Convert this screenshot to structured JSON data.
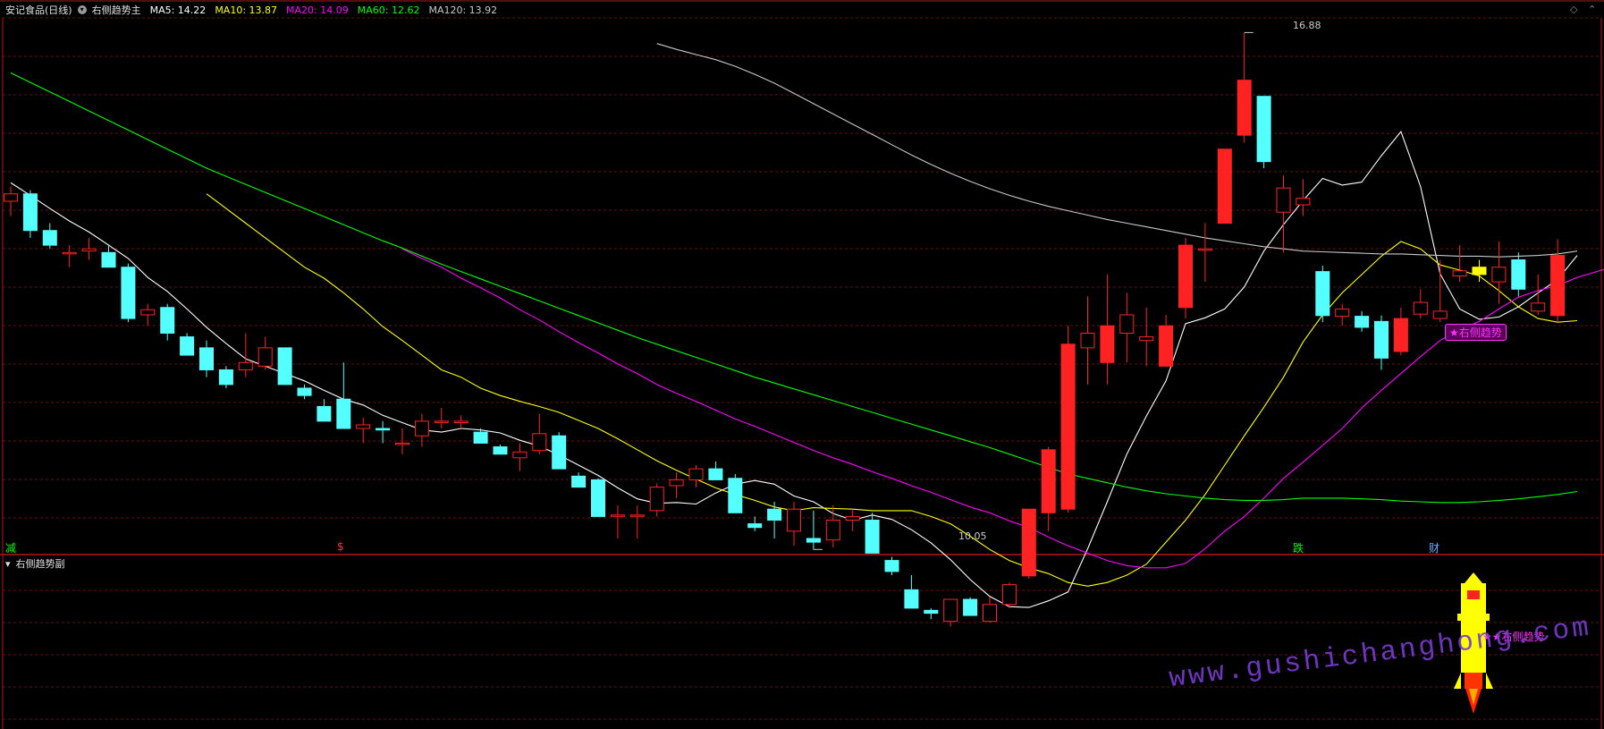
{
  "header": {
    "stock_name": "安记食品(日线)",
    "indicator": "右侧趋势主",
    "ma_labels": [
      {
        "text": "MA5: 14.22",
        "color": "#ffffff"
      },
      {
        "text": "MA10: 13.87",
        "color": "#ffff00"
      },
      {
        "text": "MA20: 14.09",
        "color": "#ff00ff"
      },
      {
        "text": "MA60: 12.62",
        "color": "#00ff00"
      },
      {
        "text": "MA120: 13.92",
        "color": "#c8c8c8"
      }
    ]
  },
  "sub_panel": {
    "title": "右侧趋势副"
  },
  "markers": {
    "m1": {
      "text": "减",
      "color": "#00ff00"
    },
    "m2": {
      "text": "$",
      "color": "#ff3333"
    },
    "m3": {
      "text": "跌",
      "color": "#00ff00"
    },
    "m4": {
      "text": "财",
      "color": "#66aaff"
    }
  },
  "annotations": {
    "high_label": "16.88",
    "low_label": "10.05",
    "signal_label": "★右侧趋势",
    "rocket_label": "★★右侧趋势"
  },
  "watermark": "www.gushichanghong.com",
  "colors": {
    "up": "#ff2222",
    "down": "#54ffff",
    "grid": "#8a1515",
    "border": "#b01818",
    "ma5": "#ffffff",
    "ma10": "#ffff00",
    "ma20": "#ff00ff",
    "ma60": "#00ff00",
    "ma120": "#c8c8c8",
    "highlight": "#ffff00"
  },
  "chart_data": {
    "type": "candlestick",
    "ylim": [
      10.0,
      17.1
    ],
    "series_ohlc": [
      [
        14.6,
        14.8,
        14.4,
        14.7
      ],
      [
        14.7,
        14.75,
        14.1,
        14.2
      ],
      [
        14.2,
        14.3,
        13.95,
        14.0
      ],
      [
        13.9,
        14.0,
        13.7,
        13.9
      ],
      [
        13.92,
        14.1,
        13.8,
        13.95
      ],
      [
        13.9,
        14.0,
        13.7,
        13.7
      ],
      [
        13.7,
        13.75,
        12.95,
        13.0
      ],
      [
        13.05,
        13.2,
        12.9,
        13.12
      ],
      [
        13.15,
        13.2,
        12.7,
        12.8
      ],
      [
        12.75,
        12.8,
        12.5,
        12.5
      ],
      [
        12.6,
        12.7,
        12.2,
        12.3
      ],
      [
        12.3,
        12.35,
        12.05,
        12.1
      ],
      [
        12.3,
        12.8,
        12.2,
        12.4
      ],
      [
        12.35,
        12.75,
        12.3,
        12.6
      ],
      [
        12.6,
        12.6,
        12.1,
        12.1
      ],
      [
        12.05,
        12.1,
        11.9,
        11.95
      ],
      [
        11.8,
        11.9,
        11.6,
        11.6
      ],
      [
        11.9,
        12.4,
        11.5,
        11.5
      ],
      [
        11.5,
        11.65,
        11.3,
        11.55
      ],
      [
        11.5,
        11.6,
        11.3,
        11.48
      ],
      [
        11.3,
        11.5,
        11.15,
        11.3
      ],
      [
        11.4,
        11.7,
        11.25,
        11.6
      ],
      [
        11.6,
        11.78,
        11.5,
        11.6
      ],
      [
        11.58,
        11.68,
        11.5,
        11.6
      ],
      [
        11.45,
        11.5,
        11.3,
        11.3
      ],
      [
        11.25,
        11.28,
        11.15,
        11.15
      ],
      [
        11.1,
        11.3,
        10.92,
        11.18
      ],
      [
        11.2,
        11.7,
        11.15,
        11.43
      ],
      [
        11.4,
        11.45,
        10.95,
        10.95
      ],
      [
        10.85,
        10.9,
        10.7,
        10.7
      ],
      [
        10.8,
        10.82,
        10.3,
        10.3
      ],
      [
        10.32,
        10.45,
        10.0,
        10.32
      ],
      [
        10.32,
        10.45,
        10.0,
        10.32
      ],
      [
        10.38,
        10.75,
        10.3,
        10.7
      ],
      [
        10.72,
        10.9,
        10.55,
        10.8
      ],
      [
        10.8,
        11.0,
        10.7,
        10.95
      ],
      [
        10.95,
        11.05,
        10.82,
        10.8
      ],
      [
        10.82,
        10.88,
        10.35,
        10.35
      ],
      [
        10.2,
        10.3,
        10.1,
        10.15
      ],
      [
        10.4,
        10.5,
        10.0,
        10.25
      ],
      [
        10.1,
        10.5,
        9.9,
        10.4
      ],
      [
        10.0,
        10.38,
        9.85,
        9.95
      ],
      [
        9.98,
        10.45,
        9.88,
        10.25
      ],
      [
        10.25,
        10.4,
        10.1,
        10.3
      ],
      [
        10.25,
        10.35,
        9.8,
        9.8
      ],
      [
        9.7,
        9.75,
        9.5,
        9.55
      ],
      [
        9.3,
        9.5,
        9.05,
        9.05
      ],
      [
        9.02,
        9.05,
        8.9,
        8.98
      ],
      [
        8.87,
        9.17,
        8.8,
        9.17
      ],
      [
        9.17,
        9.2,
        8.95,
        8.95
      ],
      [
        8.87,
        9.2,
        8.85,
        9.1
      ],
      [
        9.1,
        9.4,
        9.05,
        9.37
      ],
      [
        9.49,
        10.4,
        9.45,
        10.4
      ],
      [
        10.35,
        11.25,
        10.1,
        11.21
      ],
      [
        10.4,
        12.9,
        10.35,
        12.65
      ],
      [
        12.6,
        13.3,
        12.1,
        12.8
      ],
      [
        12.4,
        13.6,
        12.1,
        12.9
      ],
      [
        12.8,
        13.35,
        12.4,
        13.05
      ],
      [
        12.7,
        13.15,
        12.35,
        12.75
      ],
      [
        12.35,
        13.05,
        12.35,
        12.9
      ],
      [
        13.15,
        14.1,
        13.0,
        14.0
      ],
      [
        13.95,
        14.3,
        13.5,
        13.95
      ],
      [
        14.3,
        15.3,
        14.3,
        15.31
      ],
      [
        15.5,
        16.9,
        15.4,
        16.25
      ],
      [
        16.03,
        15.94,
        15.05,
        15.14
      ],
      [
        14.45,
        14.95,
        13.9,
        14.78
      ],
      [
        14.55,
        14.9,
        14.4,
        14.64
      ],
      [
        13.64,
        13.72,
        12.95,
        13.04
      ],
      [
        13.03,
        13.2,
        12.9,
        13.13
      ],
      [
        13.03,
        13.1,
        12.82,
        12.88
      ],
      [
        12.96,
        13.04,
        12.3,
        12.46
      ],
      [
        12.55,
        13.15,
        12.5,
        13.0
      ],
      [
        13.06,
        13.4,
        13.0,
        13.22
      ],
      [
        13.0,
        13.8,
        12.95,
        13.1
      ],
      [
        13.58,
        14.0,
        13.5,
        13.65
      ],
      [
        13.7,
        13.8,
        13.5,
        13.6
      ],
      [
        13.5,
        14.05,
        13.2,
        13.7
      ],
      [
        13.8,
        13.9,
        13.3,
        13.4
      ],
      [
        13.1,
        13.6,
        13.05,
        13.21
      ],
      [
        13.04,
        14.08,
        12.95,
        13.86
      ]
    ],
    "ma_series": [
      {
        "name": "MA5",
        "color": "#ffffff",
        "values": [
          14.85,
          14.68,
          14.5,
          14.33,
          14.18,
          14.0,
          13.82,
          13.56,
          13.37,
          13.13,
          12.88,
          12.66,
          12.45,
          12.35,
          12.25,
          12.15,
          12.02,
          11.9,
          11.82,
          11.68,
          11.58,
          11.48,
          11.45,
          11.5,
          11.48,
          11.44,
          11.34,
          11.26,
          11.14,
          11.0,
          10.86,
          10.69,
          10.54,
          10.48,
          10.49,
          10.47,
          10.62,
          10.74,
          10.79,
          10.74,
          10.58,
          10.5,
          10.34,
          10.25,
          10.32,
          10.26,
          10.12,
          9.94,
          9.71,
          9.44,
          9.21,
          9.07,
          9.06,
          9.15,
          9.27,
          9.86,
          10.5,
          11.15,
          11.67,
          12.15,
          12.93,
          13.01,
          13.13,
          13.43,
          13.92,
          14.28,
          14.61,
          14.91,
          14.82,
          14.86,
          15.22,
          15.55,
          14.8,
          13.61,
          13.13,
          12.99,
          13.02,
          13.16,
          13.35,
          13.53,
          13.86
        ]
      },
      {
        "name": "MA10",
        "color": "#ffff00",
        "values": [
          null,
          null,
          null,
          null,
          null,
          null,
          null,
          null,
          null,
          null,
          14.7,
          14.5,
          14.3,
          14.1,
          13.9,
          13.7,
          13.55,
          13.35,
          13.13,
          12.89,
          12.7,
          12.5,
          12.3,
          12.2,
          12.05,
          11.95,
          11.87,
          11.8,
          11.72,
          11.61,
          11.5,
          11.36,
          11.21,
          11.06,
          10.93,
          10.81,
          10.69,
          10.6,
          10.52,
          10.43,
          10.38,
          10.42,
          10.41,
          10.4,
          10.38,
          10.38,
          10.38,
          10.3,
          10.2,
          10.03,
          9.85,
          9.7,
          9.6,
          9.52,
          9.4,
          9.35,
          9.4,
          9.5,
          9.65,
          9.95,
          10.25,
          10.6,
          11.0,
          11.4,
          11.79,
          12.2,
          12.68,
          13.05,
          13.35,
          13.6,
          13.85,
          14.05,
          13.95,
          13.73,
          13.66,
          13.58,
          13.38,
          13.16,
          13.0,
          12.95,
          12.97
        ]
      },
      {
        "name": "MA20",
        "color": "#ff00ff",
        "values": [
          null,
          null,
          null,
          null,
          null,
          null,
          null,
          null,
          null,
          null,
          null,
          null,
          null,
          null,
          null,
          null,
          null,
          null,
          null,
          null,
          13.95,
          13.82,
          13.7,
          13.55,
          13.42,
          13.28,
          13.12,
          12.98,
          12.82,
          12.67,
          12.53,
          12.38,
          12.25,
          12.1,
          11.98,
          11.87,
          11.75,
          11.63,
          11.53,
          11.42,
          11.31,
          11.2,
          11.1,
          11.01,
          10.91,
          10.82,
          10.72,
          10.63,
          10.53,
          10.43,
          10.35,
          10.24,
          10.15,
          10.02,
          9.9,
          9.8,
          9.7,
          9.63,
          9.6,
          9.6,
          9.66,
          9.86,
          10.1,
          10.3,
          10.55,
          10.82,
          11.04,
          11.27,
          11.5,
          11.78,
          12.02,
          12.25,
          12.48,
          12.7,
          12.85,
          12.96,
          13.13,
          13.29,
          13.38,
          13.45,
          13.56,
          13.64,
          13.72,
          13.82
        ]
      },
      {
        "name": "MA60",
        "color": "#00ff00",
        "values": [
          16.35,
          16.22,
          16.09,
          15.96,
          15.83,
          15.7,
          15.57,
          15.44,
          15.31,
          15.18,
          15.05,
          14.94,
          14.83,
          14.72,
          14.61,
          14.5,
          14.39,
          14.28,
          14.17,
          14.06,
          13.96,
          13.85,
          13.74,
          13.64,
          13.54,
          13.44,
          13.34,
          13.24,
          13.14,
          13.04,
          12.94,
          12.84,
          12.74,
          12.65,
          12.56,
          12.47,
          12.38,
          12.29,
          12.2,
          12.12,
          12.04,
          11.96,
          11.88,
          11.8,
          11.72,
          11.64,
          11.56,
          11.48,
          11.4,
          11.32,
          11.24,
          11.15,
          11.06,
          10.97,
          10.88,
          10.82,
          10.76,
          10.7,
          10.65,
          10.61,
          10.58,
          10.55,
          10.53,
          10.52,
          10.52,
          10.53,
          10.55,
          10.55,
          10.55,
          10.54,
          10.53,
          10.51,
          10.5,
          10.49,
          10.49,
          10.5,
          10.52,
          10.54,
          10.57,
          10.6,
          10.64
        ]
      },
      {
        "name": "MA120",
        "color": "#c8c8c8",
        "values": [
          null,
          null,
          null,
          null,
          null,
          null,
          null,
          null,
          null,
          null,
          null,
          null,
          null,
          null,
          null,
          null,
          null,
          null,
          null,
          null,
          null,
          null,
          null,
          null,
          null,
          null,
          null,
          null,
          null,
          null,
          null,
          null,
          null,
          16.75,
          16.67,
          16.6,
          16.53,
          16.44,
          16.33,
          16.21,
          16.07,
          15.93,
          15.79,
          15.65,
          15.51,
          15.37,
          15.23,
          15.1,
          14.98,
          14.87,
          14.77,
          14.68,
          14.6,
          14.53,
          14.47,
          14.41,
          14.35,
          14.3,
          14.25,
          14.2,
          14.15,
          14.1,
          14.06,
          14.02,
          13.98,
          13.95,
          13.92,
          13.91,
          13.9,
          13.89,
          13.88,
          13.88,
          13.87,
          13.86,
          13.85,
          13.85,
          13.84,
          13.85,
          13.86,
          13.88,
          13.92
        ]
      }
    ],
    "rocket": {
      "color": "#ffff00"
    }
  }
}
